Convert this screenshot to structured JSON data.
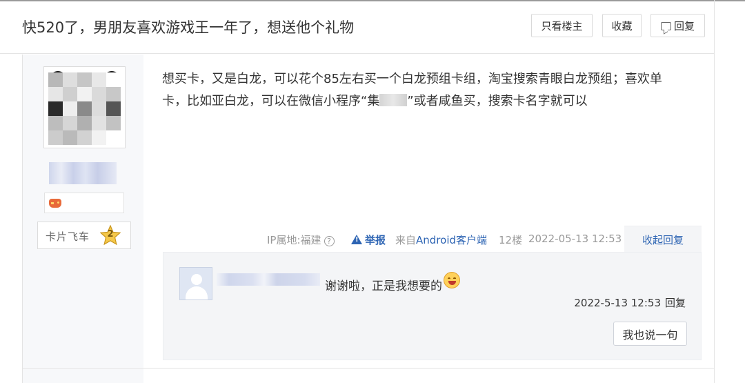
{
  "thread": {
    "title": "快520了，男朋友喜欢游戏王一年了，想送他个礼物",
    "buttons": {
      "only_op": "只看楼主",
      "favorite": "收藏",
      "reply": "回复"
    }
  },
  "post": {
    "author": {
      "badge_label": "卡片飞车",
      "badge_level": "2"
    },
    "content": {
      "line1": "想买卡，又是白龙，可以花个85左右买一个白龙预组卡组，淘宝搜索青眼白龙预组；喜欢单",
      "line2_before": "卡，比如亚白龙，可以在微信小程序“集",
      "line2_after": "”或者咸鱼买，搜索卡名字就可以"
    },
    "meta": {
      "ip_location": "IP属地:福建",
      "help_glyph": "?",
      "report": "举报",
      "client_prefix": "来自",
      "client": "Android客户端",
      "floor": "12楼",
      "datetime": "2022-05-13 12:53",
      "collapse_replies": "收起回复"
    },
    "reply": {
      "text": "谢谢啦，正是我想要的",
      "time": "2022-5-13 12:53",
      "reply_link": "回复",
      "say_button": "我也说一句"
    }
  },
  "colors": {
    "link_blue": "#2d64b3",
    "muted_gray": "#999999",
    "panel_bg": "#f4f5f7"
  },
  "icons": [
    "help-icon",
    "warning-icon",
    "reply-icon",
    "star-badge-icon",
    "game-controller-icon",
    "smile-emoji-icon"
  ]
}
